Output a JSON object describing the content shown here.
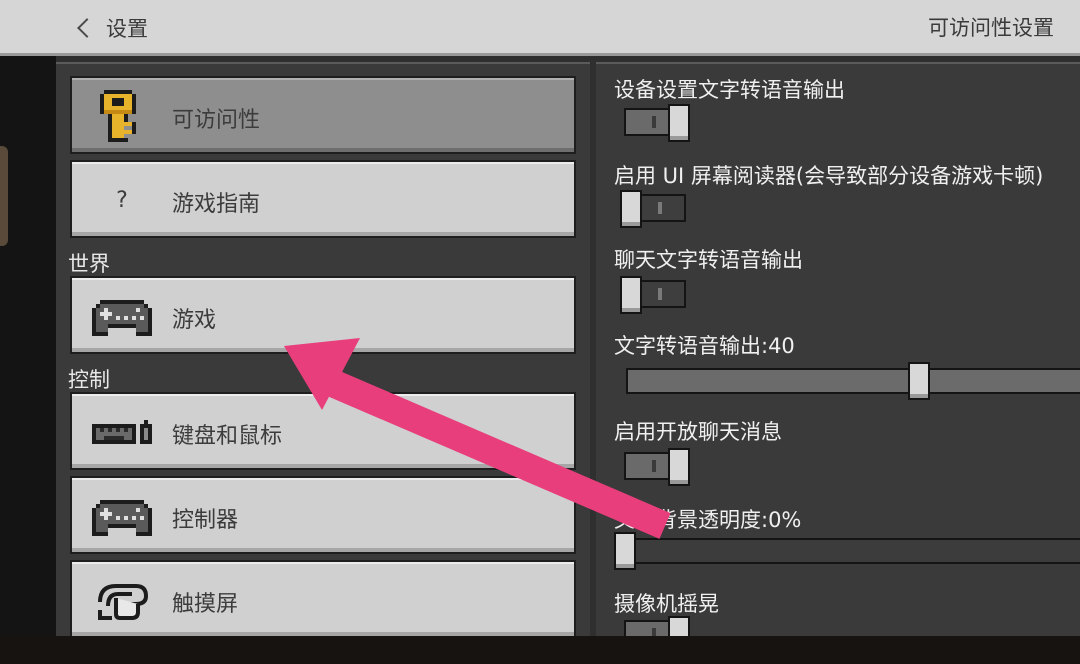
{
  "header": {
    "back_label": "设置",
    "title": "可访问性设置"
  },
  "left_panel": {
    "items_top": [
      {
        "label": "可访问性",
        "icon": "key-icon",
        "active": true
      },
      {
        "label": "游戏指南",
        "icon": "question-icon",
        "active": false
      }
    ],
    "sections": [
      {
        "title": "世界",
        "items": [
          {
            "label": "游戏",
            "icon": "gamepad-icon"
          }
        ]
      },
      {
        "title": "控制",
        "items": [
          {
            "label": "键盘和鼠标",
            "icon": "keyboard-mouse-icon"
          },
          {
            "label": "控制器",
            "icon": "gamepad-icon"
          },
          {
            "label": "触摸屏",
            "icon": "touch-icon"
          }
        ]
      }
    ],
    "question_glyph": "?"
  },
  "right_panel": {
    "options": [
      {
        "label": "设备设置文字转语音输出",
        "type": "toggle",
        "value": true
      },
      {
        "label": "启用 UI 屏幕阅读器(会导致部分设备游戏卡顿)",
        "type": "toggle",
        "value": false
      },
      {
        "label": "聊天文字转语音输出",
        "type": "toggle",
        "value": false
      },
      {
        "label": "文字转语音输出:40",
        "type": "slider",
        "value": 0.6
      },
      {
        "label": "启用开放聊天消息",
        "type": "toggle",
        "value": true
      },
      {
        "label": "文本背景透明度:0%",
        "type": "slider",
        "value": 0
      },
      {
        "label": "摄像机摇晃",
        "type": "toggle",
        "value": true
      }
    ]
  },
  "annotation": {
    "arrow_color": "#e83e7c"
  },
  "colors": {
    "button_face": "#d0d0d0",
    "button_active": "#8e8e8e",
    "panel_bg": "#3a3a3a",
    "header_bg": "#d6d6d6"
  }
}
